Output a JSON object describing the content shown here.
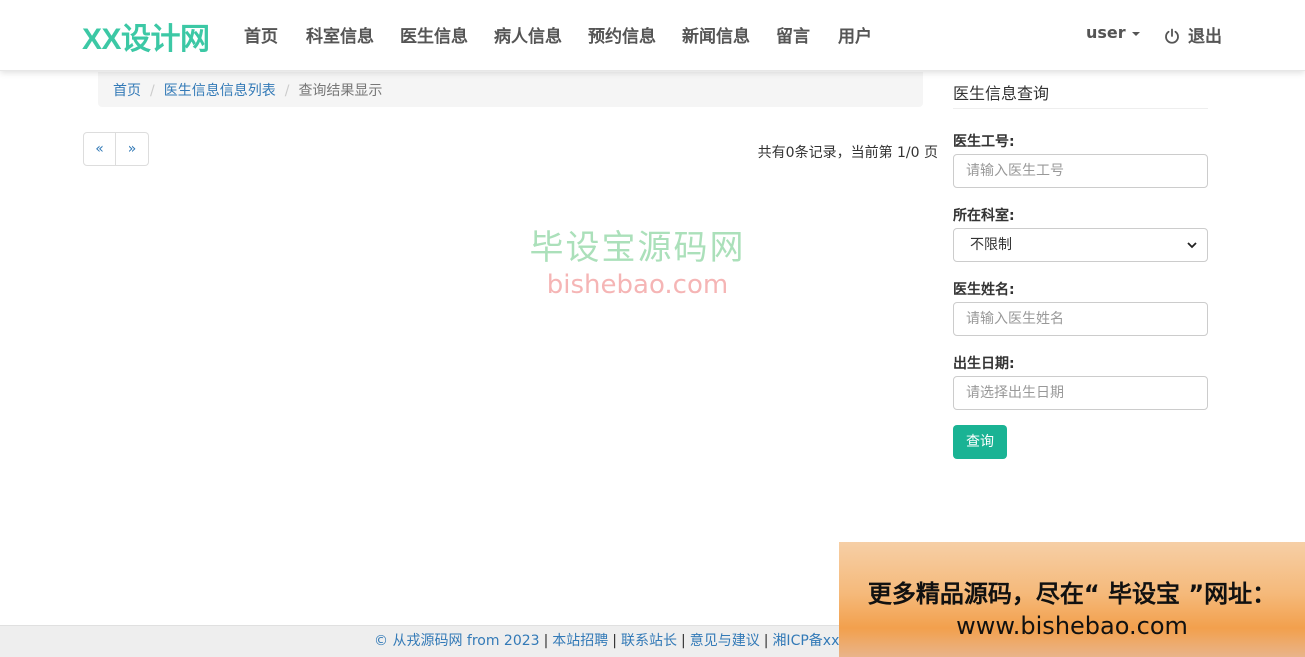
{
  "navbar": {
    "brand": "XX设计网",
    "items": [
      "首页",
      "科室信息",
      "医生信息",
      "病人信息",
      "预约信息",
      "新闻信息",
      "留言",
      "用户"
    ],
    "user_label": "user",
    "logout_label": "退出"
  },
  "breadcrumb": {
    "home": "首页",
    "list": "医生信息信息列表",
    "current": "查询结果显示"
  },
  "pagination": {
    "prev": "«",
    "next": "»",
    "record_info": "共有0条记录，当前第 1/0 页"
  },
  "watermark": {
    "cn": "毕设宝源码网",
    "en": "bishebao.com"
  },
  "sidebar": {
    "title": "医生信息查询",
    "fields": {
      "doctor_id_label": "医生工号:",
      "doctor_id_placeholder": "请输入医生工号",
      "department_label": "所在科室:",
      "department_value": "不限制",
      "doctor_name_label": "医生姓名:",
      "doctor_name_placeholder": "请输入医生姓名",
      "birth_date_label": "出生日期:",
      "birth_date_placeholder": "请选择出生日期"
    },
    "search_button": "查询"
  },
  "footer": {
    "copyright": "© 从戎源码网 from 2023",
    "links": [
      "本站招聘",
      "联系站长",
      "意见与建议",
      "湘ICP备xxxx"
    ]
  },
  "ad": {
    "line1": "更多精品源码，尽在“ 毕设宝 ”网址：",
    "line2": "www.bishebao.com"
  },
  "colors": {
    "brand": "#3cc8a5",
    "link": "#337ab7",
    "button": "#1ab394"
  }
}
